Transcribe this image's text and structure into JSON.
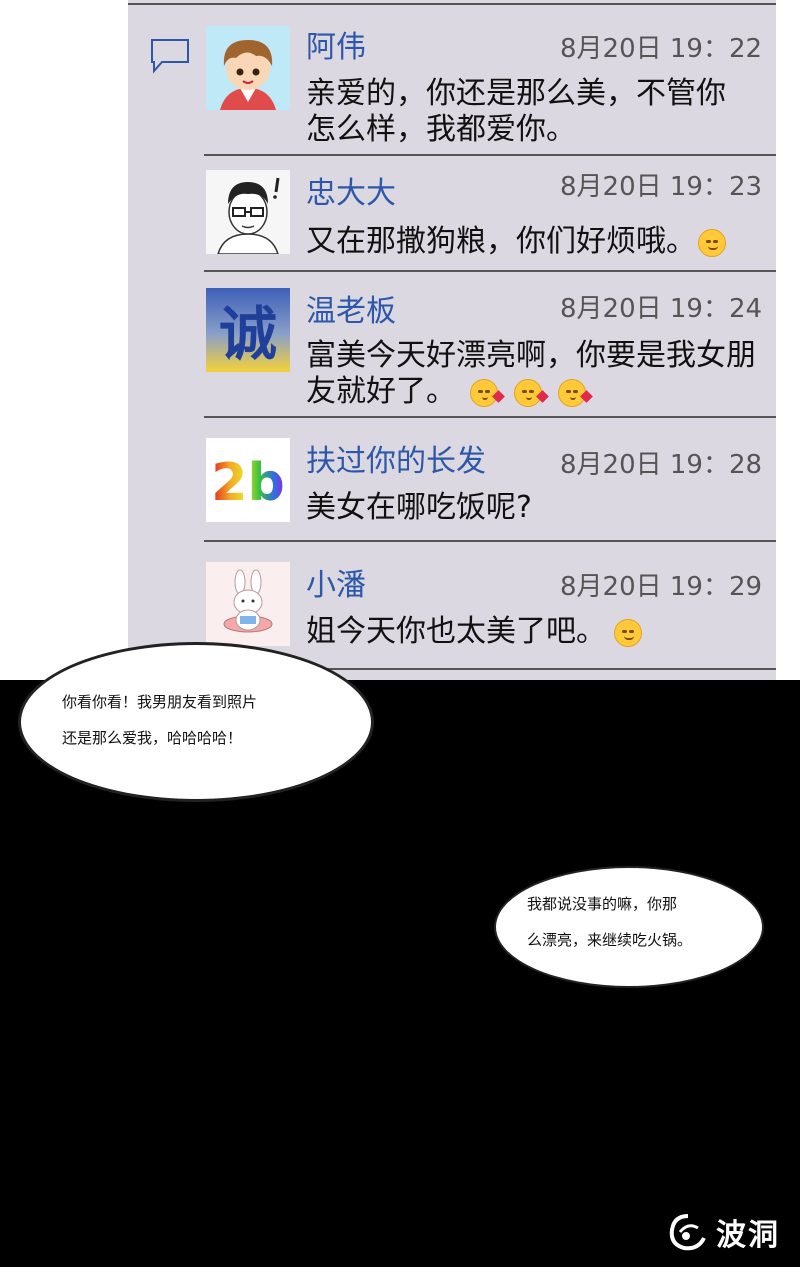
{
  "comments": [
    {
      "name": "阿伟",
      "time": "8月20日 19：22",
      "text": "亲爱的，你还是那么美，不管你怎么样，我都爱你。",
      "emojis": []
    },
    {
      "name": "忠大大",
      "time": "8月20日 19：23",
      "text": "又在那撒狗粮，你们好烦哦。",
      "emojis": [
        "unamused-face"
      ]
    },
    {
      "name": "温老板",
      "time": "8月20日 19：24",
      "text": "富美今天好漂亮啊，你要是我女朋友就好了。",
      "emojis": [
        "kissing-heart-face",
        "kissing-heart-face",
        "kissing-heart-face"
      ]
    },
    {
      "name": "扶过你的长发",
      "time": "8月20日 19：28",
      "text": "美女在哪吃饭呢?",
      "emojis": []
    },
    {
      "name": "小潘",
      "time": "8月20日 19：29",
      "text": "姐今天你也太美了吧。",
      "emojis": [
        "smiling-face"
      ]
    }
  ],
  "avatars": {
    "a1": "cartoon-boy-avatar",
    "a2": "sketch-glasses-avatar",
    "a3": "calligraphy-cheng",
    "a3_glyph": "诚",
    "a4": "rainbow-2b",
    "a4_glyph": "2b",
    "a5": "bunny-avatar"
  },
  "bubbles": {
    "left": {
      "line1": "你看你看！我男朋友看到照片",
      "line2": "还是那么爱我，哈哈哈哈！"
    },
    "right": {
      "line1": "我都说没事的嘛，你那",
      "line2": "么漂亮，来继续吃火锅。"
    }
  },
  "watermark": {
    "text": "波洞"
  },
  "colors": {
    "panel": "#dcd8e2",
    "name": "#2d57a8",
    "background": "#000000"
  }
}
